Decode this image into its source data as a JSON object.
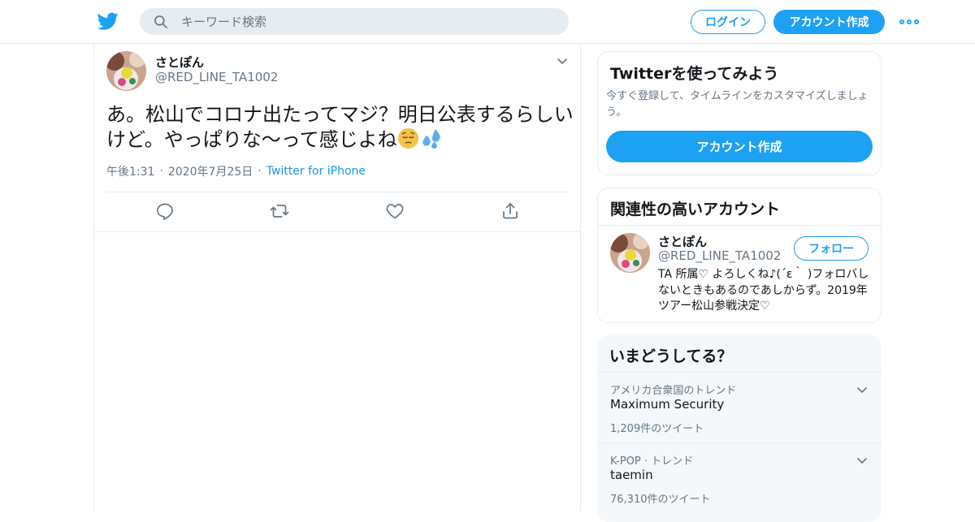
{
  "header": {
    "search_placeholder": "キーワード検索",
    "login_label": "ログイン",
    "signup_label": "アカウント作成",
    "brand_color": "#1da1f2"
  },
  "tweet": {
    "author_name": "さとぽん",
    "author_handle": "@RED_LINE_TA1002",
    "text": "あ。松山でコロナ出たってマジ？明日公表するらしいけど。やっぱりな〜って感じよね",
    "emojis": [
      "pensive-face-emoji",
      "sweat-droplets-emoji"
    ],
    "time": "午後1:31",
    "date": "2020年7月25日",
    "source": "Twitter for iPhone",
    "actions": [
      "reply-icon",
      "retweet-icon",
      "like-icon",
      "share-icon"
    ]
  },
  "sidebar": {
    "signup_card": {
      "title": "Twitterを使ってみよう",
      "description": "今すぐ登録して、タイムラインをカスタマイズしましょう。",
      "button_label": "アカウント作成"
    },
    "related_card": {
      "title": "関連性の高いアカウント",
      "account": {
        "name": "さとぽん",
        "handle": "@RED_LINE_TA1002",
        "follow_label": "フォロー",
        "bio": "TA 所属♡ よろしくね♪(´ε｀ )フォロバしないときもあるのであしからず。2019年ツアー松山参戦決定♡"
      }
    },
    "trends_card": {
      "title": "いまどうしてる？",
      "trends": [
        {
          "meta": "アメリカ合衆国のトレンド",
          "name": "Maximum Security",
          "count": "1,209件のツイート"
        },
        {
          "meta": "K-POP · トレンド",
          "name": "taemin",
          "count": "76,310件のツイート"
        }
      ]
    }
  }
}
